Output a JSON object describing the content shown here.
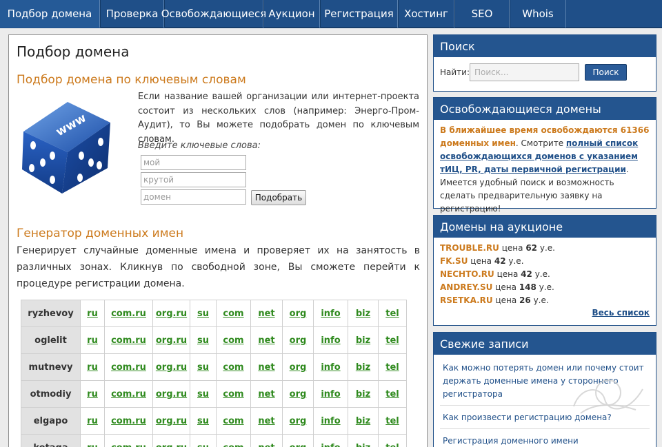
{
  "nav": {
    "items": [
      {
        "label": "Подбор домена",
        "width": 145,
        "active": true
      },
      {
        "label": "Проверка",
        "width": 93
      },
      {
        "label": "Освобождающиеся",
        "width": 144
      },
      {
        "label": "Аукцион",
        "width": 82
      },
      {
        "label": "Регистрация",
        "width": 113
      },
      {
        "label": "Хостинг",
        "width": 82
      },
      {
        "label": "SEO",
        "width": 80
      },
      {
        "label": "Whois",
        "width": 82
      }
    ]
  },
  "main": {
    "title": "Подбор домена",
    "keywords_section": {
      "title": "Подбор домена по ключевым словам",
      "intro": "Если название вашей организации или интернет-проекта состоит из нескольких слов (например: Энерго-Пром-Аудит), то Вы можете подобрать домен по ключевым словам.",
      "label": "Введите ключевые слова:",
      "inputs": [
        "мой",
        "крутой",
        "домен"
      ],
      "button": "Подобрать"
    },
    "generator_section": {
      "title": "Генератор доменных имен",
      "text": "Генерирует случайные доменные имена и проверяет их на занятость в различных зонах. Кликнув по свободной зоне, Вы сможете перейти к процедуре регистрации домена."
    },
    "zones": [
      "ru",
      "com.ru",
      "org.ru",
      "su",
      "com",
      "net",
      "org",
      "info",
      "biz",
      "tel"
    ],
    "names": [
      "ryzhevoy",
      "oglelit",
      "mutnevy",
      "otmodiy",
      "elgapo",
      "kotaga"
    ]
  },
  "sidebar": {
    "search": {
      "title": "Поиск",
      "label": "Найти:",
      "placeholder": "Поиск...",
      "button": "Поиск"
    },
    "free": {
      "title": "Освобождающиеся домены",
      "highlight": "В ближайшее время освобождаются 61366 доменных имен",
      "text1": ". Смотрите ",
      "link": "полный список освобождающихся доменов с указанием тИЦ, PR, даты первичной регистрации",
      "text2": ". Имеется удобный поиск и возможность сделать предварительную заявку на регистрацию!"
    },
    "auction": {
      "title": "Домены на аукционе",
      "price_word": "цена",
      "unit": "у.е.",
      "items": [
        {
          "domain": "TROUBLE.RU",
          "price": "62"
        },
        {
          "domain": "FK.SU",
          "price": "42"
        },
        {
          "domain": "NECHTO.RU",
          "price": "42"
        },
        {
          "domain": "ANDREY.SU",
          "price": "148"
        },
        {
          "domain": "RSETKA.RU",
          "price": "26"
        }
      ],
      "all_link": "Весь список"
    },
    "posts": {
      "title": "Свежие записи",
      "items": [
        "Как можно потерять домен или почему стоит держать доменные имена у стороннего регистратора",
        "Как произвести регистрацию домена?",
        "Регистрация доменного имени"
      ]
    }
  },
  "colors": {
    "nav": "#1f4f88",
    "accent_orange": "#cc7a1d",
    "zone_green": "#2f8a1e"
  },
  "icons": {
    "dice": "www-dice-icon"
  }
}
